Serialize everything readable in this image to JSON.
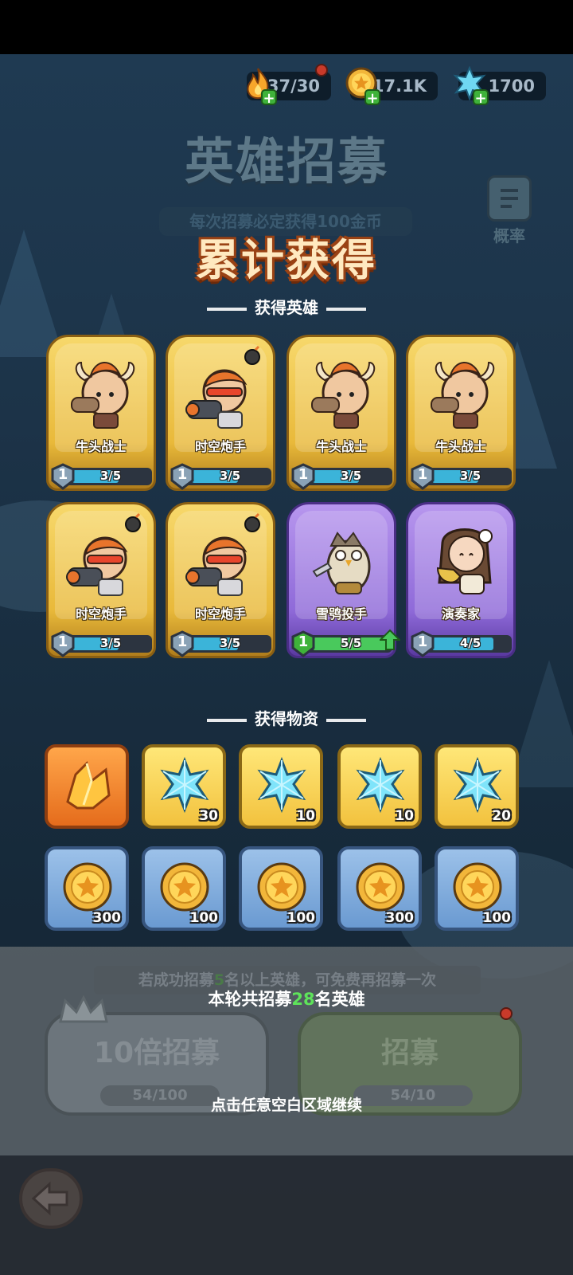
{
  "resources": [
    {
      "name": "stamina",
      "value": "37/30",
      "icon": "flame-icon"
    },
    {
      "name": "gold",
      "value": "17.1K",
      "icon": "gold-coin-icon"
    },
    {
      "name": "crystal",
      "value": "1700",
      "icon": "blue-crystal-icon"
    }
  ],
  "header": {
    "title": "英雄招募",
    "subtitle": "每次招募必定获得100金币",
    "prob_label": "概率"
  },
  "overlay": {
    "title": "累计获得",
    "heroes_section": "获得英雄",
    "items_section": "获得物资"
  },
  "heroes": [
    {
      "name": "牛头战士",
      "level": "1",
      "progress": "3/5",
      "fraction": 0.6,
      "rarity": "gold",
      "icon": "minotaur-warrior-icon"
    },
    {
      "name": "时空炮手",
      "level": "1",
      "progress": "3/5",
      "fraction": 0.6,
      "rarity": "gold",
      "icon": "time-gunner-icon"
    },
    {
      "name": "牛头战士",
      "level": "1",
      "progress": "3/5",
      "fraction": 0.6,
      "rarity": "gold",
      "icon": "minotaur-warrior-icon"
    },
    {
      "name": "牛头战士",
      "level": "1",
      "progress": "3/5",
      "fraction": 0.6,
      "rarity": "gold",
      "icon": "minotaur-warrior-icon"
    },
    {
      "name": "时空炮手",
      "level": "1",
      "progress": "3/5",
      "fraction": 0.6,
      "rarity": "gold",
      "icon": "time-gunner-icon"
    },
    {
      "name": "时空炮手",
      "level": "1",
      "progress": "3/5",
      "fraction": 0.6,
      "rarity": "gold",
      "icon": "time-gunner-icon"
    },
    {
      "name": "雪鸮投手",
      "level": "1",
      "progress": "5/5",
      "fraction": 1.0,
      "rarity": "purple",
      "icon": "snow-owl-thrower-icon",
      "upgradable": true
    },
    {
      "name": "演奏家",
      "level": "1",
      "progress": "4/5",
      "fraction": 0.8,
      "rarity": "purple",
      "icon": "musician-icon"
    }
  ],
  "items": [
    {
      "icon": "gold-crystal-icon",
      "count": "",
      "bg": "orange"
    },
    {
      "icon": "blue-crystal-icon",
      "count": "30",
      "bg": "yellow"
    },
    {
      "icon": "blue-crystal-icon",
      "count": "10",
      "bg": "yellow"
    },
    {
      "icon": "blue-crystal-icon",
      "count": "10",
      "bg": "yellow"
    },
    {
      "icon": "blue-crystal-icon",
      "count": "20",
      "bg": "yellow"
    },
    {
      "icon": "gold-coin-icon",
      "count": "300",
      "bg": "blue"
    },
    {
      "icon": "gold-coin-icon",
      "count": "100",
      "bg": "blue"
    },
    {
      "icon": "gold-coin-icon",
      "count": "100",
      "bg": "blue"
    },
    {
      "icon": "gold-coin-icon",
      "count": "300",
      "bg": "blue"
    },
    {
      "icon": "gold-coin-icon",
      "count": "100",
      "bg": "blue"
    }
  ],
  "footer": {
    "free_tip_pre": "若成功招募",
    "free_tip_num": "5",
    "free_tip_post": "名以上英雄，可免费再招募一次",
    "round_pre": "本轮共招募",
    "round_num": "28",
    "round_post": "名英雄",
    "ten_label": "10倍招募",
    "ten_cost": "54/100",
    "recruit_label": "招募",
    "recruit_cost": "54/10",
    "continue": "点击任意空白区域继续"
  },
  "colors": {
    "gold_card": "#e9b93a",
    "purple_card": "#8f6ad9",
    "title_fill": "#ffe9c0",
    "title_outline": "#9a4214",
    "highlight_green": "#5ee35a"
  }
}
